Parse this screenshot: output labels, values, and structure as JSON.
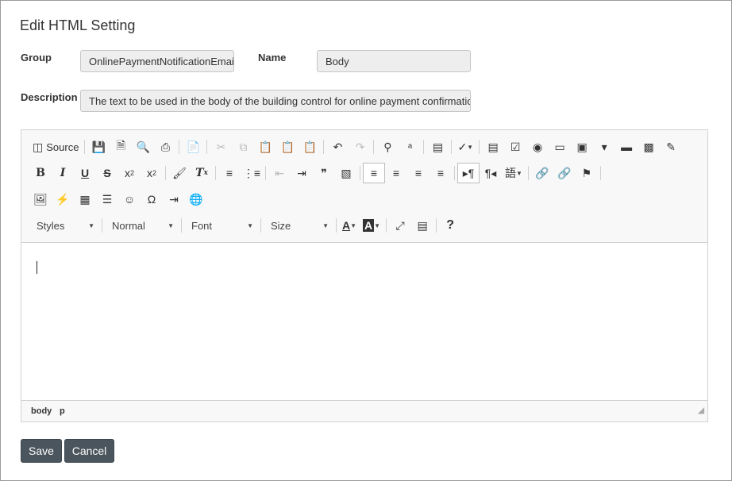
{
  "page": {
    "title": "Edit HTML Setting"
  },
  "form": {
    "group_label": "Group",
    "group_value": "OnlinePaymentNotificationEmail",
    "name_label": "Name",
    "name_value": "Body",
    "description_label": "Description",
    "description_value": "The text to be used in the body of the building control for online payment confirmation e-r"
  },
  "toolbar": {
    "source_label": "Source",
    "styles_label": "Styles",
    "format_label": "Normal",
    "font_label": "Font",
    "size_label": "Size"
  },
  "editor": {
    "path": [
      "body",
      "p"
    ]
  },
  "actions": {
    "save_label": "Save",
    "cancel_label": "Cancel"
  }
}
